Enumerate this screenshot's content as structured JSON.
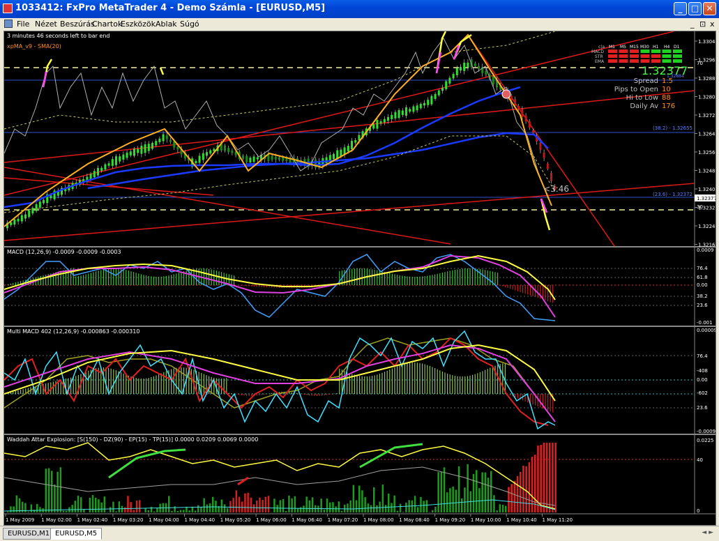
{
  "window": {
    "title": "1033412: FxPro MetaTrader 4 - Demo Számla - [EURUSD,M5]",
    "minimize_glyph": "_",
    "maximize_glyph": "□",
    "close_glyph": "✕",
    "mdi_controls": [
      "_",
      "⊡",
      "x"
    ]
  },
  "menu": [
    "File",
    "Nézet",
    "Beszúrás",
    "Chartok",
    "Eszközök",
    "Ablak",
    "Súgó"
  ],
  "main_panel": {
    "header": "3 minutes 46 seconds left to bar end",
    "indicator_label": "xpMA_v9 - SMA(20)",
    "price_axis": [
      "1.33045",
      "1.32965",
      "1.32885",
      "1.32805",
      "1.32725",
      "1.32645",
      "1.32565",
      "1.32485",
      "1.32405",
      "1.32325",
      "1.32245",
      "1.32165"
    ],
    "current_price_tag": "1.32377",
    "level_70": "70",
    "level_30": "30",
    "countdown": "<3:46",
    "fib_382": "(38.2) - 1.32655",
    "fib_236": "(23.6) - 1.32372",
    "fib_top": "1.32884",
    "info": {
      "price": "1.32377",
      "spread_label": "Spread",
      "spread_value": "1.5",
      "pips_label": "Pips to Open",
      "pips_value": "10",
      "hilo_label": "Hi to Low",
      "hilo_value": "88",
      "daily_label": "Daily Av",
      "daily_value": "176"
    },
    "signal_grid": {
      "corner": "c|a",
      "timeframes": [
        "M1",
        "M5",
        "M15",
        "M30",
        "H1",
        "H4",
        "D1"
      ],
      "rows": [
        "MACD",
        "STR",
        "EMA"
      ],
      "colors": {
        "red": "#e02020",
        "green": "#20d020"
      }
    }
  },
  "macd_panel": {
    "label": "MACD (12,26,9) -0.0009 -0.0009 -0.0003",
    "axis": [
      "0.0009",
      "76.4",
      "61.8",
      "0.00",
      "38.2",
      "23.6",
      "-0.001"
    ]
  },
  "multi_macd_panel": {
    "label": "Multi MACD 402 (12,26,9) -0.000863 -0.000310",
    "axis": [
      "0.000097",
      "76.4",
      "-408",
      "0.00",
      "-602",
      "23.6",
      "-0.00094"
    ]
  },
  "waddah_panel": {
    "label": "Waddah Attar Explosion: [S(150) - DZ(90) - EP(15) - TP(15)] 0.0000 0.0209 0.0069 0.0000",
    "axis": [
      "0.0225",
      "40",
      "0"
    ]
  },
  "time_axis": [
    "1 May 2009",
    "1 May 02:00",
    "1 May 02:40",
    "1 May 03:20",
    "1 May 04:00",
    "1 May 04:40",
    "1 May 05:20",
    "1 May 06:00",
    "1 May 06:40",
    "1 May 07:20",
    "1 May 08:00",
    "1 May 08:40",
    "1 May 09:20",
    "1 May 10:00",
    "1 May 10:40",
    "1 May 11:20"
  ],
  "tabs": [
    "EURUSD,M1",
    "EURUSD,M5"
  ],
  "active_tab": "EURUSD,M5",
  "tab_arrows": "◄ ►"
}
